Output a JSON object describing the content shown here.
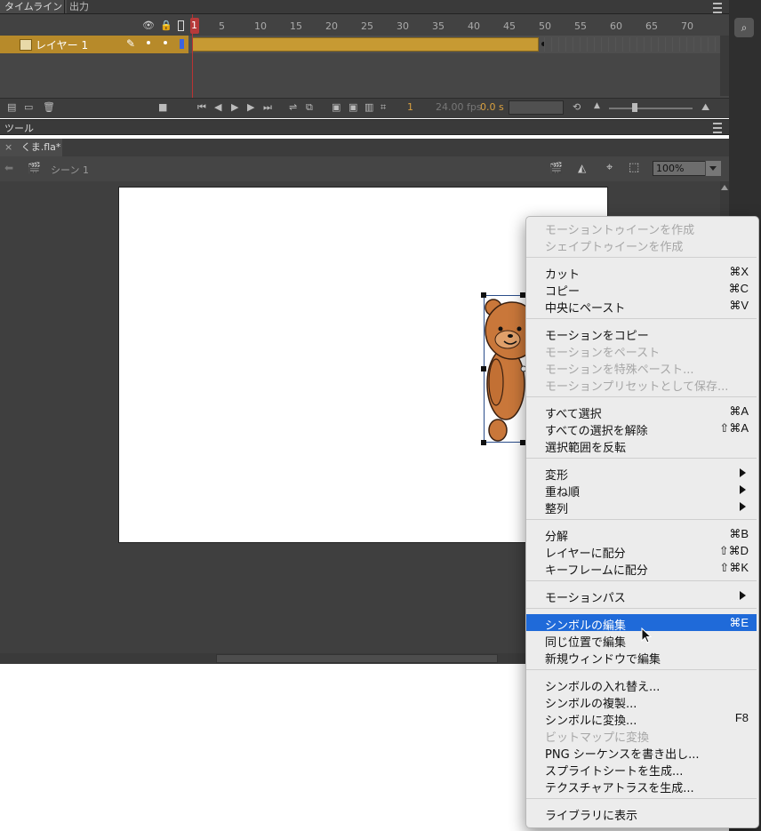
{
  "panel_tabs": {
    "timeline": "タイムライン",
    "output": "出力"
  },
  "timeline": {
    "layer_name": "レイヤー 1",
    "current_frame": "1",
    "frame_numbers": [
      "5",
      "10",
      "15",
      "20",
      "25",
      "30",
      "35",
      "40",
      "45",
      "50",
      "55",
      "60",
      "65",
      "70"
    ],
    "playback": {
      "frame": "1",
      "fps": "24.00 fps",
      "time": "0.0 s"
    }
  },
  "tools_panel": {
    "label": "ツール"
  },
  "document": {
    "tab": "くま.fla*",
    "scene": "シーン 1",
    "zoom": "100%"
  },
  "context_menu": {
    "sections": [
      [
        {
          "label": "モーショントゥイーンを作成",
          "disabled": true
        },
        {
          "label": "シェイプトゥイーンを作成",
          "disabled": true
        }
      ],
      [
        {
          "label": "カット",
          "shortcut": "⌘X"
        },
        {
          "label": "コピー",
          "shortcut": "⌘C"
        },
        {
          "label": "中央にペースト",
          "shortcut": "⌘V"
        }
      ],
      [
        {
          "label": "モーションをコピー"
        },
        {
          "label": "モーションをペースト",
          "disabled": true
        },
        {
          "label": "モーションを特殊ペースト...",
          "disabled": true
        },
        {
          "label": "モーションプリセットとして保存...",
          "disabled": true
        }
      ],
      [
        {
          "label": "すべて選択",
          "shortcut": "⌘A"
        },
        {
          "label": "すべての選択を解除",
          "shortcut": "⇧⌘A"
        },
        {
          "label": "選択範囲を反転"
        }
      ],
      [
        {
          "label": "変形",
          "submenu": true
        },
        {
          "label": "重ね順",
          "submenu": true
        },
        {
          "label": "整列",
          "submenu": true
        }
      ],
      [
        {
          "label": "分解",
          "shortcut": "⌘B"
        },
        {
          "label": "レイヤーに配分",
          "shortcut": "⇧⌘D"
        },
        {
          "label": "キーフレームに配分",
          "shortcut": "⇧⌘K"
        }
      ],
      [
        {
          "label": "モーションパス",
          "submenu": true
        }
      ],
      [
        {
          "label": "シンボルの編集",
          "shortcut": "⌘E",
          "highlighted": true
        },
        {
          "label": "同じ位置で編集"
        },
        {
          "label": "新規ウィンドウで編集"
        }
      ],
      [
        {
          "label": "シンボルの入れ替え..."
        },
        {
          "label": "シンボルの複製..."
        },
        {
          "label": "シンボルに変換...",
          "shortcut": "F8"
        },
        {
          "label": "ビットマップに変換",
          "disabled": true
        },
        {
          "label": "PNG シーケンスを書き出し..."
        },
        {
          "label": "スプライトシートを生成..."
        },
        {
          "label": "テクスチャアトラスを生成..."
        }
      ],
      [
        {
          "label": "ライブラリに表示"
        }
      ]
    ]
  },
  "colors": {
    "highlight": "#1f6ad9",
    "layer_span": "#c79a33",
    "playhead": "#b63a3a",
    "bear": "#c9773a"
  }
}
